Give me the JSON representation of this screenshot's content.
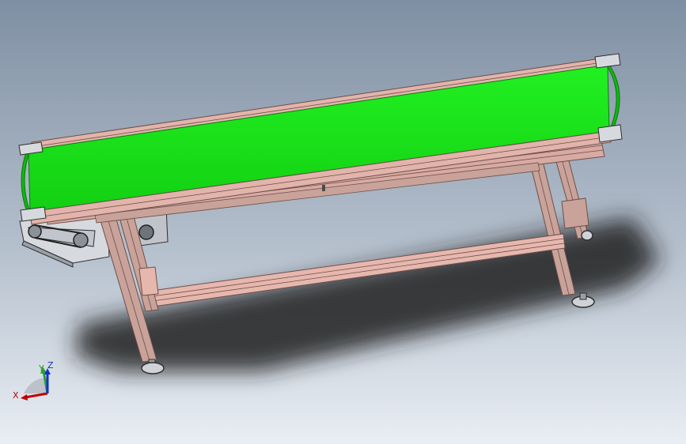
{
  "view": {
    "background_top": "#7f8fa3",
    "background_bottom": "#e9eef4"
  },
  "model": {
    "belt_color": "#19e819",
    "belt_shade": "#0fb80f",
    "frame_color": "#c9a29a",
    "frame_edge": "#6b4f4a",
    "metal_color": "#d6d9de",
    "shadow_color": "#1d1d1d"
  },
  "triad": {
    "x_label": "X",
    "y_label": "Y",
    "z_label": "Z",
    "x_color": "#c00000",
    "y_color": "#2aa02a",
    "z_color": "#1030d0"
  }
}
